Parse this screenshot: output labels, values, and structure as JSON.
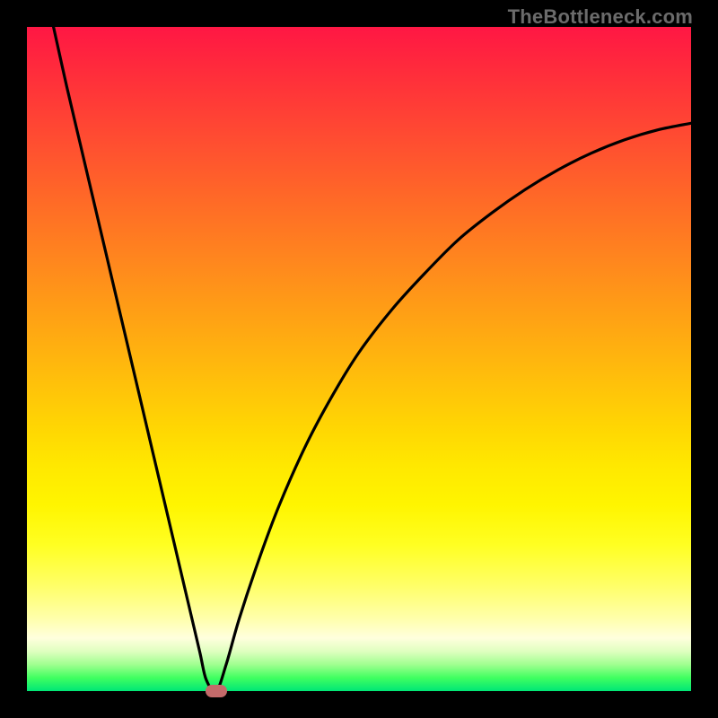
{
  "watermark": "TheBottleneck.com",
  "chart_data": {
    "type": "line",
    "title": "",
    "xlabel": "",
    "ylabel": "",
    "xlim": [
      0,
      100
    ],
    "ylim": [
      0,
      100
    ],
    "grid": false,
    "legend": false,
    "background_gradient": {
      "top_color": "#ff1744",
      "bottom_color": "#00e676",
      "description": "vertical rainbow gradient red→orange→yellow→green"
    },
    "series": [
      {
        "name": "bottleneck-curve",
        "x": [
          4,
          6,
          8,
          10,
          12,
          14,
          16,
          18,
          20,
          22,
          24,
          26,
          27,
          28.5,
          30,
          32,
          35,
          38,
          42,
          46,
          50,
          55,
          60,
          65,
          70,
          75,
          80,
          85,
          90,
          95,
          100
        ],
        "values": [
          100,
          91,
          82.5,
          74,
          65.5,
          57,
          48.5,
          40,
          31.5,
          23,
          14.5,
          6,
          1.7,
          0,
          4,
          11,
          20,
          28,
          37,
          44.5,
          51,
          57.5,
          63,
          68,
          72,
          75.5,
          78.5,
          81,
          83,
          84.5,
          85.5
        ]
      }
    ],
    "marker": {
      "x": 28.5,
      "y": 0,
      "color": "#c46a6a",
      "shape": "pill"
    }
  }
}
